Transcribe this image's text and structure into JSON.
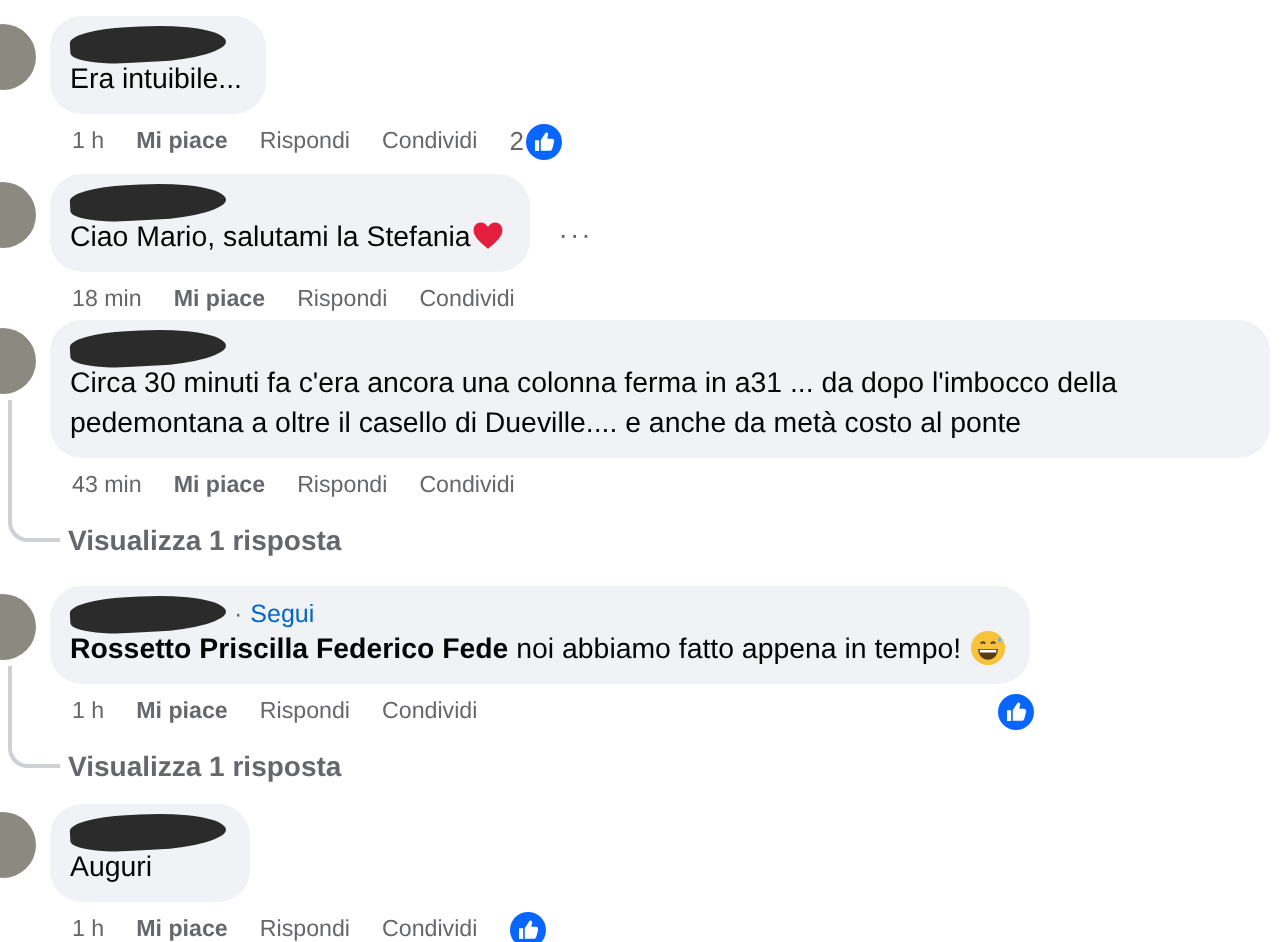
{
  "comments": [
    {
      "redacted": true,
      "text": "Era intuibile...",
      "time": "1 h",
      "actions": [
        "Mi piace",
        "Rispondi",
        "Condividi"
      ],
      "reaction": {
        "kind": "inline",
        "count": "2"
      }
    },
    {
      "redacted": true,
      "text": "Ciao Mario, salutami la Stefania",
      "emoji": {
        "kind": "heart"
      },
      "time": "18 min",
      "actions": [
        "Mi piace",
        "Rispondi",
        "Condividi"
      ],
      "more_label": "···"
    },
    {
      "redacted": true,
      "text": "Circa 30 minuti fa c'era ancora una colonna ferma in a31 ... da dopo l'imbocco della pedemontana a oltre il casello di Dueville.... e anche da metà costo al ponte",
      "time": "43 min",
      "actions": [
        "Mi piace",
        "Rispondi",
        "Condividi"
      ],
      "replies_link": "Visualizza 1 risposta"
    },
    {
      "redacted": true,
      "follow_separator": "·",
      "follow": "Segui",
      "text": "**Rossetto Priscilla Federico Fede** noi abbiamo fatto appena in tempo!",
      "emoji": {
        "kind": "grin"
      },
      "time": "1 h",
      "actions": [
        "Mi piace",
        "Rispondi",
        "Condividi"
      ],
      "reaction": {
        "kind": "aligned"
      },
      "replies_link": "Visualizza 1 risposta"
    },
    {
      "redacted": true,
      "text": "Auguri",
      "time": "1 h",
      "actions": [
        "Mi piace",
        "Rispondi",
        "Condividi"
      ],
      "reaction": {
        "kind": "inline"
      }
    }
  ]
}
